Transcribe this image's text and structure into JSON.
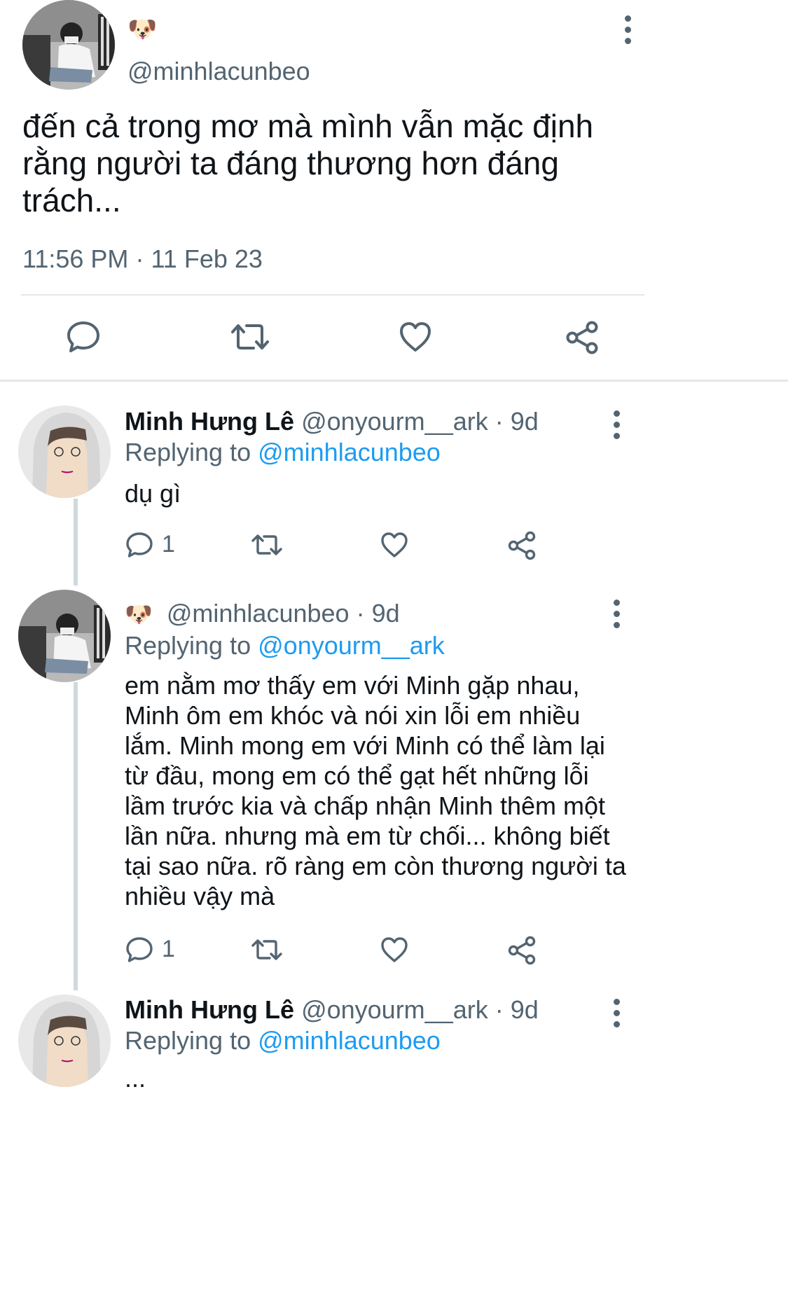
{
  "main_tweet": {
    "emoji": "🐶",
    "handle": "@minhlacunbeo",
    "text": "đến cả trong mơ mà mình vẫn mặc định rằng người ta đáng thương hơn đáng trách...",
    "time": "11:56 PM",
    "separator": "·",
    "date": "11 Feb 23",
    "actions": [
      "reply-icon",
      "retweet-icon",
      "like-icon",
      "share-icon"
    ]
  },
  "replies": [
    {
      "name": "Minh Hưng Lê",
      "handle": "@onyourm__ark",
      "meta": "· 9d",
      "replying_prefix": "Replying to",
      "replying_to": "@minhlacunbeo",
      "text": "dụ gì",
      "reply_count": "1"
    },
    {
      "emoji": "🐶",
      "handle": "@minhlacunbeo",
      "meta": "· 9d",
      "replying_prefix": "Replying to",
      "replying_to": "@onyourm__ark",
      "text": "em nằm mơ thấy em với Minh gặp nhau, Minh ôm em khóc và nói xin lỗi em nhiều lắm. Minh mong em với Minh có thể làm lại từ đầu, mong em có thể gạt hết những lỗi lầm trước kia và chấp nhận Minh thêm một lần nữa. nhưng mà em từ chối... không biết tại sao nữa. rõ ràng em còn thương người ta nhiều vậy mà",
      "reply_count": "1"
    },
    {
      "name": "Minh Hưng Lê",
      "handle": "@onyourm__ark",
      "meta": "· 9d",
      "replying_prefix": "Replying to",
      "replying_to": "@minhlacunbeo",
      "text": "..."
    }
  ],
  "colors": {
    "accent": "#1d9bf0",
    "muted": "#536471",
    "divider": "#e6e6e6",
    "thread_line": "#cfd9de"
  }
}
